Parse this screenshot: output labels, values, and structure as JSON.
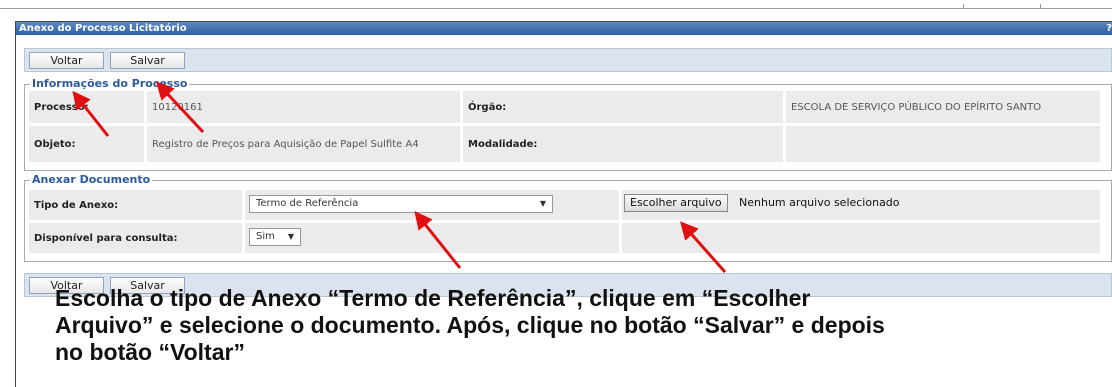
{
  "window": {
    "title": "Anexo do Processo Licitatório",
    "corner_mark": "?"
  },
  "toolbar": {
    "back_label": "Voltar",
    "save_label": "Salvar"
  },
  "process_info": {
    "legend": "Informações do Processo",
    "process_label": "Processo:",
    "process_value": "10120161",
    "organ_label": "Órgão:",
    "organ_value": "ESCOLA DE SERVIÇO PÚBLICO DO EPÍRITO SANTO",
    "object_label": "Objeto:",
    "object_value": "Registro de Preços para Aquisição de Papel Sulfite A4",
    "modality_label": "Modalidade:",
    "modality_value": ""
  },
  "attach": {
    "legend": "Anexar Documento",
    "type_label": "Tipo de Anexo:",
    "type_value": "Termo de Referência",
    "available_label": "Disponível para consulta:",
    "available_value": "Sim",
    "file_button": "Escolher arquivo",
    "file_status": "Nenhum arquivo selecionado"
  },
  "bottom_toolbar": {
    "back_label": "Voltar",
    "save_label": "Salvar"
  },
  "instruction": {
    "line1": "Escolha o tipo de Anexo “Termo de Referência”, clique em “Escolher",
    "line2": "Arquivo” e selecione o documento. Após, clique no botão “Salvar” e depois",
    "line3": "no botão “Voltar”"
  },
  "colors": {
    "titlebar": "#2f5e9e",
    "legend": "#2d5a9c",
    "arrow": "#e01010",
    "cell": "#ebebeb"
  },
  "icons": {
    "select_arrow": "chevron-down-icon",
    "annotation": "red-arrow-icon"
  }
}
